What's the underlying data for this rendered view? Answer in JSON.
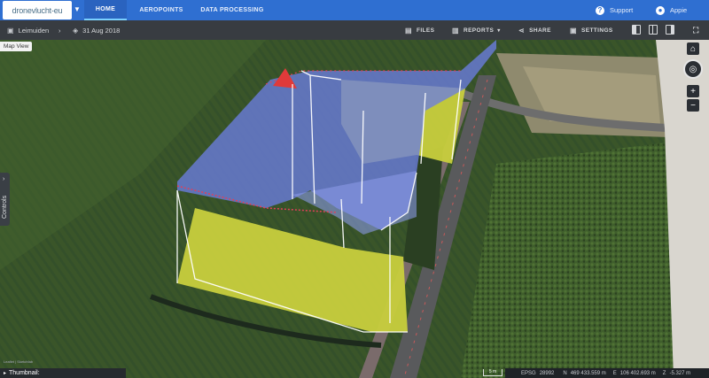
{
  "nav": {
    "logo_text": "dronevlucht-eu",
    "tabs": [
      {
        "label": "HOME",
        "active": true
      },
      {
        "label": "AEROPOINTS",
        "active": false
      },
      {
        "label": "DATA PROCESSING",
        "active": false
      }
    ],
    "support_label": "Support",
    "user_name": "Appie"
  },
  "toolbar": {
    "project_name": "Leimuiden",
    "date": "31 Aug 2018",
    "files_label": "FILES",
    "reports_label": "REPORTS",
    "share_label": "SHARE",
    "settings_label": "SETTINGS"
  },
  "map": {
    "view_label": "Map View",
    "controls_label": "Controls",
    "thumbnail_label": "Thumbnail:",
    "scale_label": "5 m",
    "crs_label": "EPSG",
    "crs_code": "28992",
    "northing_label": "N",
    "northing_value": "469 433.559 m",
    "easting_label": "E",
    "easting_value": "106 402.693 m",
    "z_label": "Z",
    "z_value": "-5.327 m",
    "attribution": "Leaflet | Sketchfab"
  },
  "colors": {
    "nav_blue": "#2f6fd1",
    "toolbar_dark": "#383c41",
    "volume_blue": "#5a6fd6",
    "base_yellow": "#d4d94a"
  }
}
